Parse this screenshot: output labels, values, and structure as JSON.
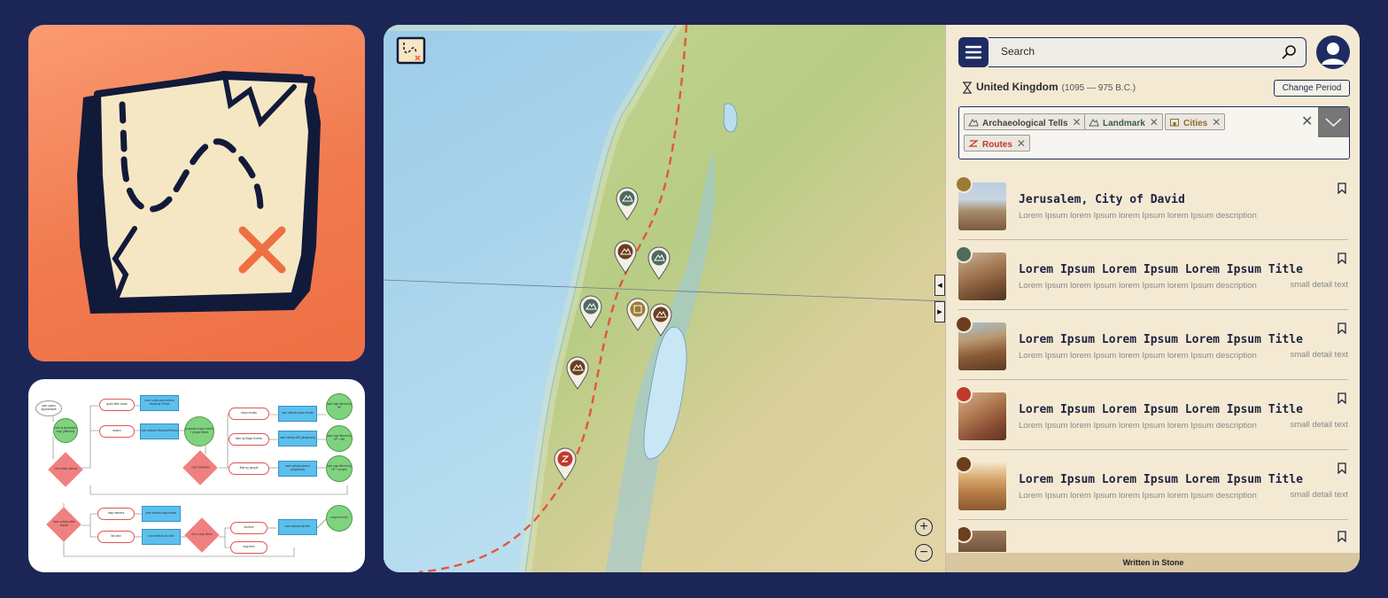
{
  "search": {
    "placeholder": "Search"
  },
  "period": {
    "name": "United Kingdom",
    "range": "(1095 — 975 B.C.)",
    "change_label": "Change Period"
  },
  "filters": [
    {
      "label": "Archaeological Tells",
      "icon": "tell-icon",
      "color": "#555555"
    },
    {
      "label": "Landmark",
      "icon": "landmark-icon",
      "color": "#4a6a5a"
    },
    {
      "label": "Cities",
      "icon": "city-icon",
      "color": "#8a6d2a"
    },
    {
      "label": "Routes",
      "icon": "route-icon",
      "color": "#c0392b"
    }
  ],
  "results": [
    {
      "title": "Jerusalem, City of David",
      "desc": "Lorem Ipsum lorem Ipsum lorem Ipsum lorem Ipsum description",
      "detail": "",
      "badge_color": "#9a7a36",
      "badge_icon": "city-icon"
    },
    {
      "title": "Lorem Ipsum Lorem Ipsum Lorem Ipsum Title",
      "desc": "Lorem Ipsum lorem Ipsum lorem Ipsum lorem Ipsum description",
      "detail": "small detail text",
      "badge_color": "#4f6a5e",
      "badge_icon": "tell-icon"
    },
    {
      "title": "Lorem Ipsum Lorem Ipsum Lorem Ipsum Title",
      "desc": "Lorem Ipsum lorem Ipsum lorem Ipsum lorem Ipsum description",
      "detail": "small detail text",
      "badge_color": "#6b3e1e",
      "badge_icon": "pickaxe-icon"
    },
    {
      "title": "Lorem Ipsum Lorem Ipsum Lorem Ipsum Title",
      "desc": "Lorem Ipsum lorem Ipsum lorem Ipsum lorem Ipsum description",
      "detail": "small detail text",
      "badge_color": "#c0392b",
      "badge_icon": "route-icon"
    },
    {
      "title": "Lorem Ipsum Lorem Ipsum Lorem Ipsum Title",
      "desc": "Lorem Ipsum lorem Ipsum lorem Ipsum lorem Ipsum description",
      "detail": "small detail text",
      "badge_color": "#6b3e1e",
      "badge_icon": "pickaxe-icon"
    }
  ],
  "footer": {
    "label": "Written in Stone"
  },
  "map": {
    "zoom_in": "+",
    "zoom_out": "−"
  },
  "flowchart": {
    "nodes": [
      "user opens app/website",
      "look at landmarks map (different)",
      "User initial options",
      "quick filter views",
      "user scrolls and selects historical Period",
      "search",
      "user selects Historical Period",
      "populate major events + people filters",
      "User Selection",
      "show results",
      "user selects show results",
      "load map filtered by HP",
      "filter by Major Events",
      "user selects ME (dropdown)",
      "load map filtered by HP + ME",
      "filter by people",
      "user selects person (dropdown)",
      "load map filtered by HP + people",
      "User options after results",
      "map markers",
      "user selects map marker",
      "list view",
      "user selects list view",
      "list or map items",
      "list item",
      "user selects list item",
      "map item",
      "map item info"
    ]
  },
  "colors": {
    "background": "#1c2656",
    "accent": "#1f2c63",
    "route": "#e2573a",
    "panel": "#f4ead3"
  }
}
